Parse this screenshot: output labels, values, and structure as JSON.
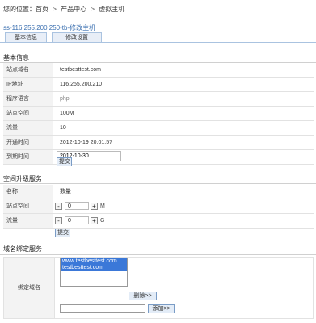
{
  "breadcrumb": {
    "items": [
      "您的位置：首页",
      "产品中心",
      "虚拟主机"
    ],
    "separator": ">"
  },
  "site_line": {
    "prefix": "ss-116.255.200.250-tb-",
    "link": "修改主机"
  },
  "tabs": [
    "基本信息",
    "修改设置"
  ],
  "basic_info": {
    "title": "基本信息",
    "rows": [
      {
        "label": "站点域名",
        "value": "testbesttest.com"
      },
      {
        "label": "IP地址",
        "value": "116.255.200.210"
      },
      {
        "label": "程序语言",
        "value": "php"
      },
      {
        "label": "站点空间",
        "value": "100M"
      },
      {
        "label": "流量",
        "value": "10"
      },
      {
        "label": "开通时间",
        "value": "2012-10-19 20:01:57"
      }
    ],
    "expire_label": "到期时间",
    "expire_value": "2012-10-30",
    "submit_label": "提交"
  },
  "upgrade": {
    "title": "空间升级服务",
    "header": {
      "label": "名称",
      "value": "数量"
    },
    "rows": [
      {
        "label": "站点空间",
        "value": "0",
        "unit": "M"
      },
      {
        "label": "流量",
        "value": "0",
        "unit": "G"
      }
    ],
    "minus": "-",
    "plus": "+",
    "submit_label": "提交"
  },
  "domain_binding": {
    "title": "域名绑定服务",
    "label": "绑定域名",
    "domains": [
      "www.testbesttest.com",
      "testbesttest.com"
    ],
    "delete_label": "删除>>",
    "add_label": "添加>>",
    "add_value": ""
  },
  "colors": {
    "link": "#3a6fb0",
    "selected": "#3b78d8",
    "tab_bg": "#e8eef7"
  }
}
